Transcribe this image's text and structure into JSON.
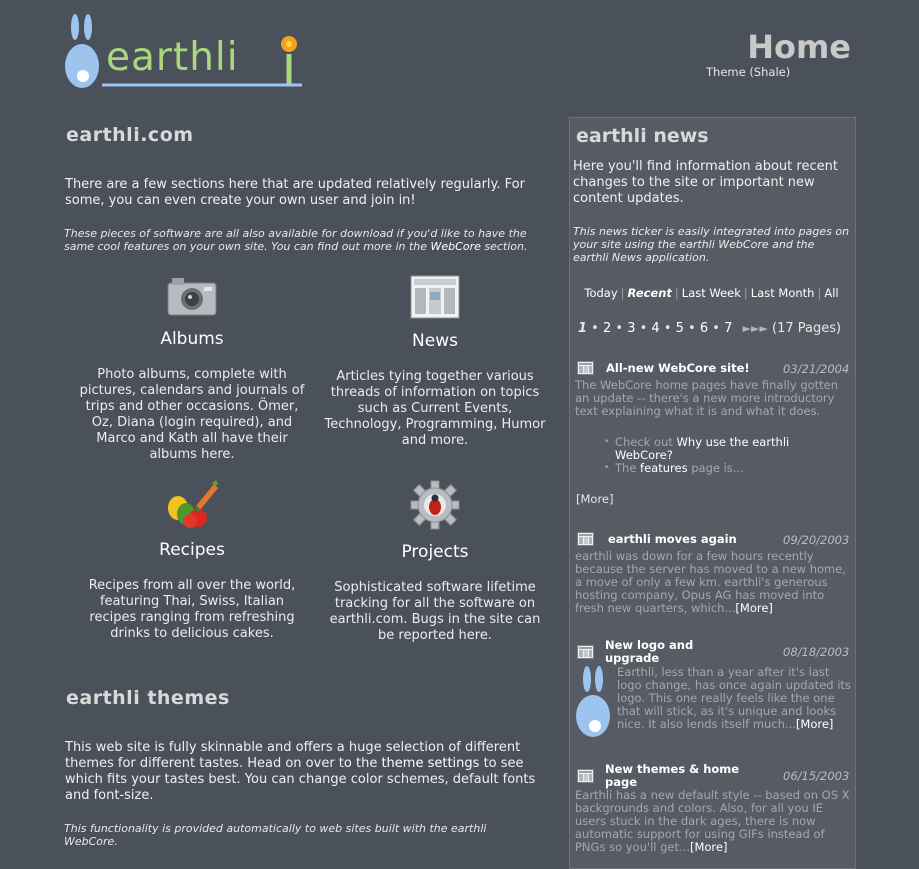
{
  "header": {
    "logo_text": "earthli",
    "page_title": "Home",
    "theme_link": "Theme (Shale)"
  },
  "intro": {
    "title": "earthli.com",
    "text": "There are a few sections here that are updated relatively regularly. For some, you can even create your own user and join in!",
    "note_pre": "These pieces of software are all also available for download if you'd like to have the same cool features on your own site. You can find out more in the ",
    "note_link": "WebCore",
    "note_post": " section."
  },
  "features": {
    "albums": {
      "title": "Albums",
      "desc": "Photo albums, complete with pictures, calendars and journals of trips and other occasions. Ömer, Oz, Diana (login required), and Marco and Kath all have their albums here."
    },
    "news": {
      "title": "News",
      "desc": "Articles tying together various threads of information on topics such as Current Events, Technology, Programming, Humor and more."
    },
    "recipes": {
      "title": "Recipes",
      "desc": "Recipes from all over the world, featuring Thai, Swiss, Italian recipes ranging from refreshing drinks to delicious cakes."
    },
    "projects": {
      "title": "Projects",
      "desc": "Sophisticated software lifetime tracking for all the software on earthli.com. Bugs in the site can be reported here."
    }
  },
  "themes": {
    "title": "earthli themes",
    "text_pre": "This web site is fully skinnable and offers a huge selection of different themes for different tastes. Head on over to the ",
    "text_link": "theme settings",
    "text_post": " to see which fits your tastes best. You can change color schemes, default fonts and font-size.",
    "note": "This functionality is provided automatically to web sites built with the earthli WebCore."
  },
  "news_panel": {
    "title": "earthli news",
    "intro": "Here you'll find information about recent changes to the site or important new content updates.",
    "note": "This news ticker is easily integrated into pages on your site using the earthli WebCore and the earthli News application.",
    "filters": [
      "Today",
      "Recent",
      "Last Week",
      "Last Month",
      "All"
    ],
    "pager": {
      "pages": [
        "1",
        "2",
        "3",
        "4",
        "5",
        "6",
        "7"
      ],
      "total": "(17 Pages)"
    },
    "items": [
      {
        "title": "All-new WebCore site!",
        "date": "03/21/2004",
        "body": "The WebCore home pages have finally gotten an update -- there's a new more introductory text explaining what it is and what it does.",
        "bullet1_pre": "Check out ",
        "bullet1_link": "Why use the earthli WebCore?",
        "bullet2_pre": "The ",
        "bullet2_link": "features",
        "bullet2_post": " page is...",
        "more": "[More]"
      },
      {
        "title": "earthli moves again",
        "date": "09/20/2003",
        "body": "earthli was down for a few hours recently because the server has moved to a new home, a move of only a few km. earthli's generous hosting company, Opus AG has moved into fresh new quarters, which...",
        "more": "[More]"
      },
      {
        "title": "New logo and upgrade",
        "date": "08/18/2003",
        "body": "Earthli, less than a year after it's last logo change, has once again updated its logo. This one really feels like the one that will stick, as it's unique and looks nice. It also lends itself much...",
        "more": "[More]"
      },
      {
        "title": "New themes & home page",
        "date": "06/15/2003",
        "body": "Earthli has a new default style -- based on OS X backgrounds and colors. Also, for all you IE users stuck in the dark ages, there is now automatic support for using GIFs instead of PNGs so you'll get...",
        "more": "[More]"
      }
    ]
  },
  "colors": {
    "background": "#4b515a",
    "panel": "#575c64",
    "logo_green": "#a9d77e",
    "logo_blue": "#9cc4ee"
  }
}
